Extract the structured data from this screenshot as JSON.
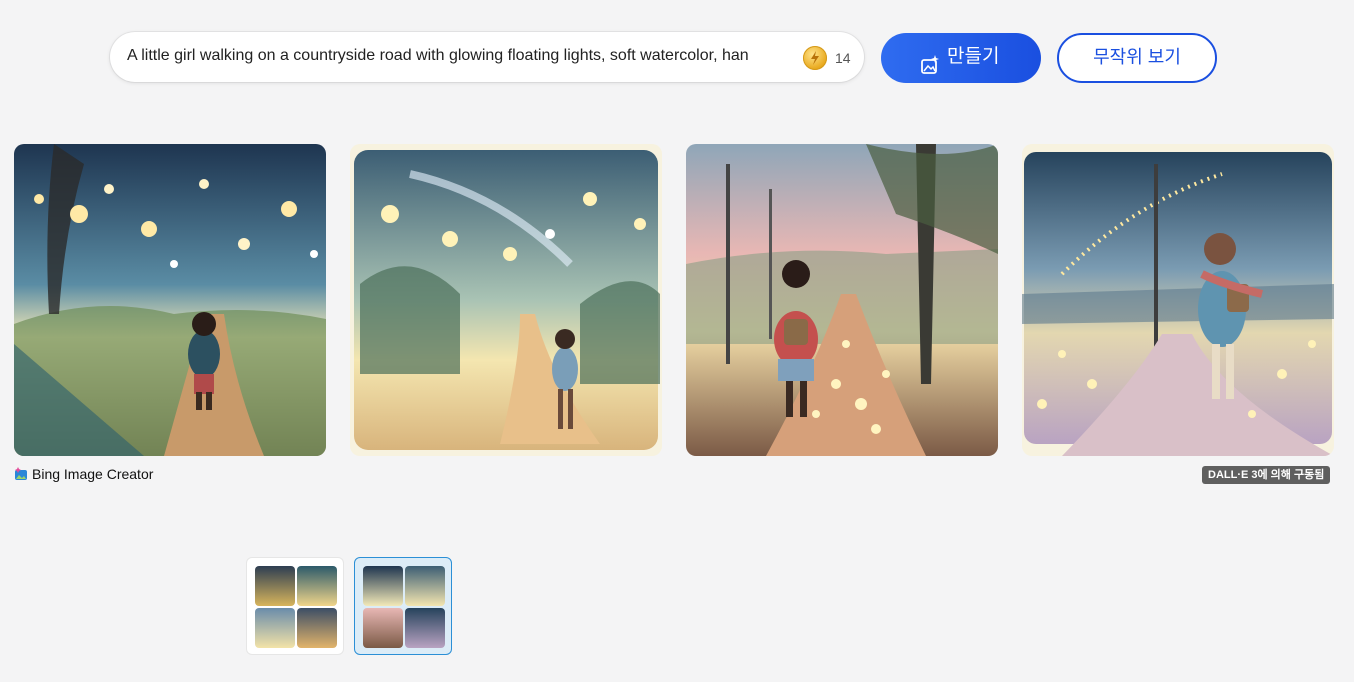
{
  "search": {
    "prompt": "A little girl walking on a countryside road with glowing floating lights, soft watercolor, han",
    "coins": "14"
  },
  "actions": {
    "create_label": "만들기",
    "random_label": "무작위 보기"
  },
  "results": {
    "images": [
      {
        "name": "night countryside road with floating lights"
      },
      {
        "name": "watercolor path with glowing orbs"
      },
      {
        "name": "girl with backpack on sunset road"
      },
      {
        "name": "girl in blue coat on twilight path"
      }
    ]
  },
  "footer": {
    "creator_label": "Bing Image Creator",
    "powered_by": "DALL·E 3에 의해 구동됨"
  },
  "history": {
    "thumbnails": [
      {
        "selected": false
      },
      {
        "selected": true
      }
    ]
  }
}
